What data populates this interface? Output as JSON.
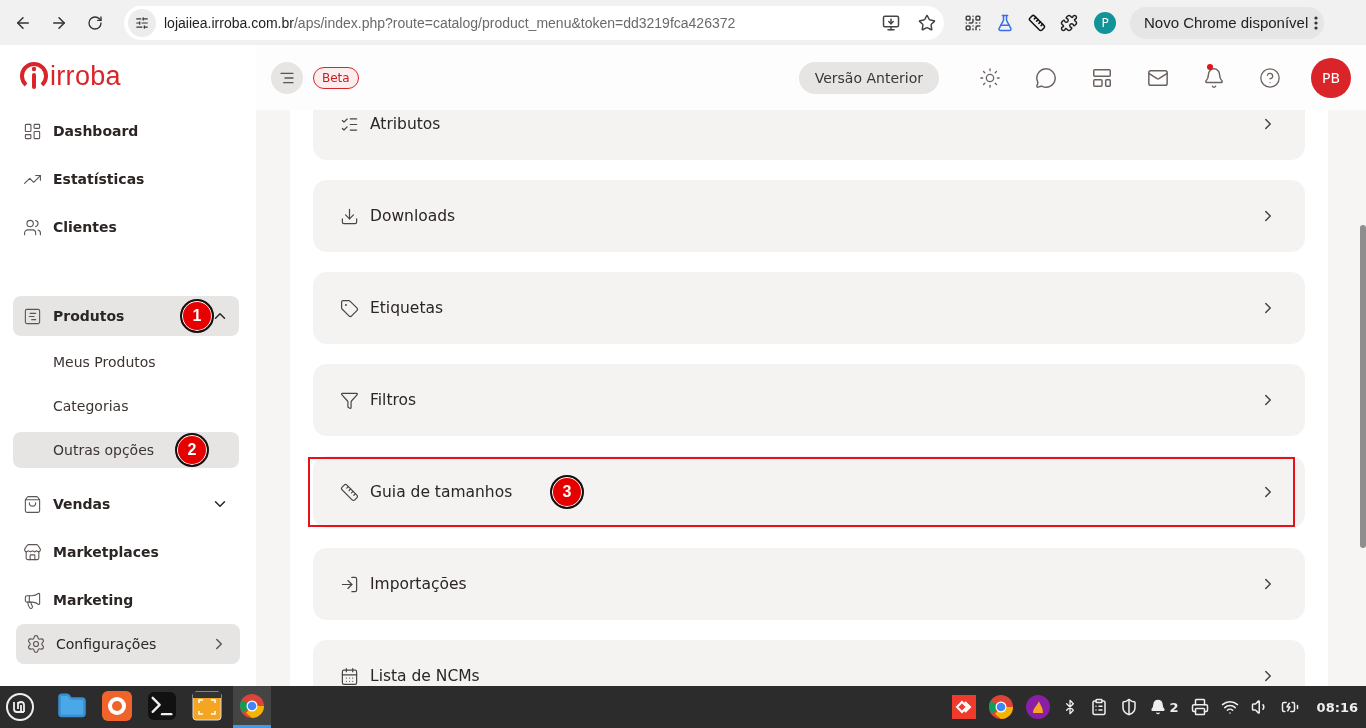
{
  "browser": {
    "url_host": "lojaiiea.irroba.com.br",
    "url_path": "/aps/index.php?route=catalog/product_menu&token=dd3219fca426372",
    "profile_initial": "P",
    "update_button": "Novo Chrome disponível"
  },
  "sidebar": {
    "logo": "irroba",
    "items": [
      {
        "label": "Dashboard",
        "selected": false
      },
      {
        "label": "Estatísticas",
        "selected": false
      },
      {
        "label": "Clientes",
        "selected": false
      },
      {
        "label": "Produtos",
        "selected": true,
        "expanded": true,
        "marker": "1",
        "children": [
          {
            "label": "Meus Produtos",
            "selected": false
          },
          {
            "label": "Categorias",
            "selected": false
          },
          {
            "label": "Outras opções",
            "selected": true,
            "marker": "2"
          }
        ]
      },
      {
        "label": "Vendas",
        "selected": false,
        "expanded": false
      },
      {
        "label": "Marketplaces",
        "selected": false
      },
      {
        "label": "Marketing",
        "selected": false
      }
    ],
    "footer_button": "Configurações"
  },
  "header": {
    "badge": "Beta",
    "previous_version_button": "Versão Anterior",
    "has_notifications": true,
    "avatar": "PB"
  },
  "cards": [
    {
      "label": "Atributos",
      "highlighted": false
    },
    {
      "label": "Downloads",
      "highlighted": false
    },
    {
      "label": "Etiquetas",
      "highlighted": false
    },
    {
      "label": "Filtros",
      "highlighted": false
    },
    {
      "label": "Guia de tamanhos",
      "highlighted": true,
      "marker": "3"
    },
    {
      "label": "Importações",
      "highlighted": false
    },
    {
      "label": "Lista de NCMs",
      "highlighted": false
    }
  ],
  "taskbar": {
    "apps": [
      {
        "selected": false
      },
      {
        "selected": false
      },
      {
        "selected": false
      },
      {
        "selected": false
      },
      {
        "selected": true
      }
    ],
    "notification_count": "2",
    "clock": "08:16"
  }
}
